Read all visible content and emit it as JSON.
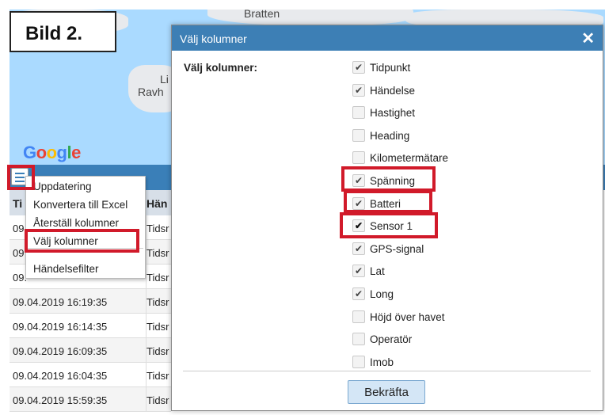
{
  "figure_label": "Bild 2.",
  "map": {
    "labels": [
      "Bratten",
      "Li",
      "Ravh"
    ],
    "google_letters": [
      {
        "ch": "G",
        "color": "#4285f4"
      },
      {
        "ch": "o",
        "color": "#ea4335"
      },
      {
        "ch": "o",
        "color": "#fbbc05"
      },
      {
        "ch": "g",
        "color": "#4285f4"
      },
      {
        "ch": "l",
        "color": "#34a853"
      },
      {
        "ch": "e",
        "color": "#ea4335"
      }
    ]
  },
  "grid": {
    "col1_header": "Ti",
    "col2_header": "Hän",
    "rows": [
      {
        "time": "09",
        "event": "Tidsr"
      },
      {
        "time": "09",
        "event": "Tidsr"
      },
      {
        "time": "09.",
        "event": "Tidsr"
      },
      {
        "time": "09.04.2019 16:19:35",
        "event": "Tidsr"
      },
      {
        "time": "09.04.2019 16:14:35",
        "event": "Tidsr"
      },
      {
        "time": "09.04.2019 16:09:35",
        "event": "Tidsr"
      },
      {
        "time": "09.04.2019 16:04:35",
        "event": "Tidsr"
      },
      {
        "time": "09.04.2019 15:59:35",
        "event": "Tidsr"
      }
    ]
  },
  "menu": {
    "items": [
      "Uppdatering",
      "Konvertera till Excel",
      "Återställ kolumner",
      "Välj kolumner",
      "Händelsefilter"
    ]
  },
  "dialog": {
    "title": "Välj kolumner",
    "close_glyph": "✕",
    "label": "Välj kolumner:",
    "check_glyph": "✔",
    "options": [
      {
        "label": "Tidpunkt",
        "checked": true
      },
      {
        "label": "Händelse",
        "checked": true
      },
      {
        "label": "Hastighet",
        "checked": false
      },
      {
        "label": "Heading",
        "checked": false
      },
      {
        "label": "Kilometermätare",
        "checked": false
      },
      {
        "label": "Spänning",
        "checked": true
      },
      {
        "label": "Batteri",
        "checked": true
      },
      {
        "label": "Sensor 1",
        "checked": true
      },
      {
        "label": "GPS-signal",
        "checked": true
      },
      {
        "label": "Lat",
        "checked": true
      },
      {
        "label": "Long",
        "checked": true
      },
      {
        "label": "Höjd över havet",
        "checked": false
      },
      {
        "label": "Operatör",
        "checked": false
      },
      {
        "label": "Imob",
        "checked": false
      }
    ],
    "confirm_label": "Bekräfta"
  },
  "colors": {
    "accent": "#3d7fb5",
    "highlight": "#d11a2a",
    "map_water": "#aadaff"
  }
}
